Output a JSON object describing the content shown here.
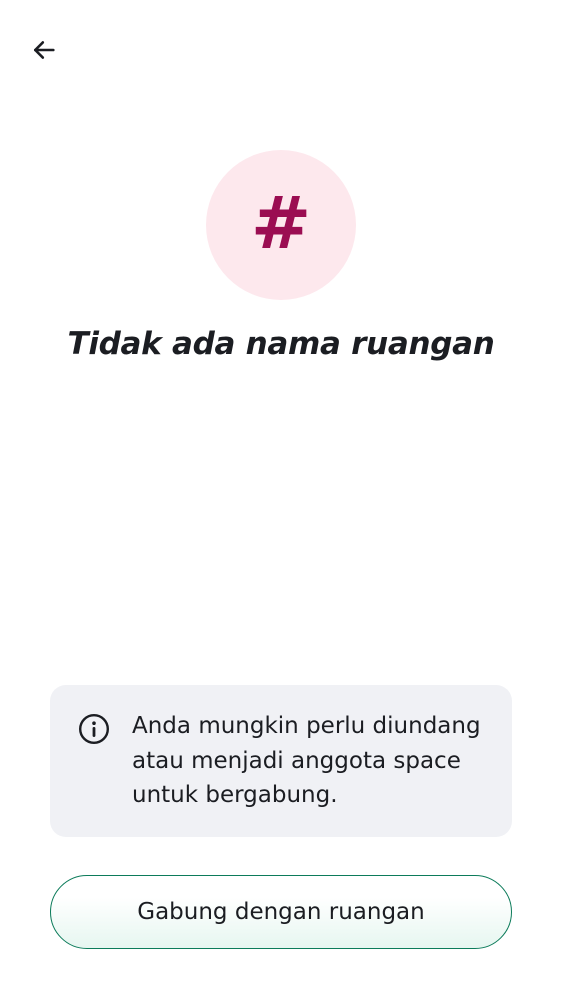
{
  "header": {
    "back_icon": "arrow-left-icon"
  },
  "room": {
    "avatar_glyph": "#",
    "title": "Tidak ada nama ruangan"
  },
  "info": {
    "icon": "info-circle-icon",
    "lines": [
      "Anda mungkin perlu diundang",
      "atau menjadi anggota space",
      "untuk bergabung."
    ]
  },
  "actions": {
    "join_label": "Gabung dengan ruangan"
  },
  "colors": {
    "accent": "#9b0d52",
    "avatar_bg": "#fde8ed",
    "button_border": "#0c7b5a",
    "card_bg": "#f0f1f5"
  }
}
